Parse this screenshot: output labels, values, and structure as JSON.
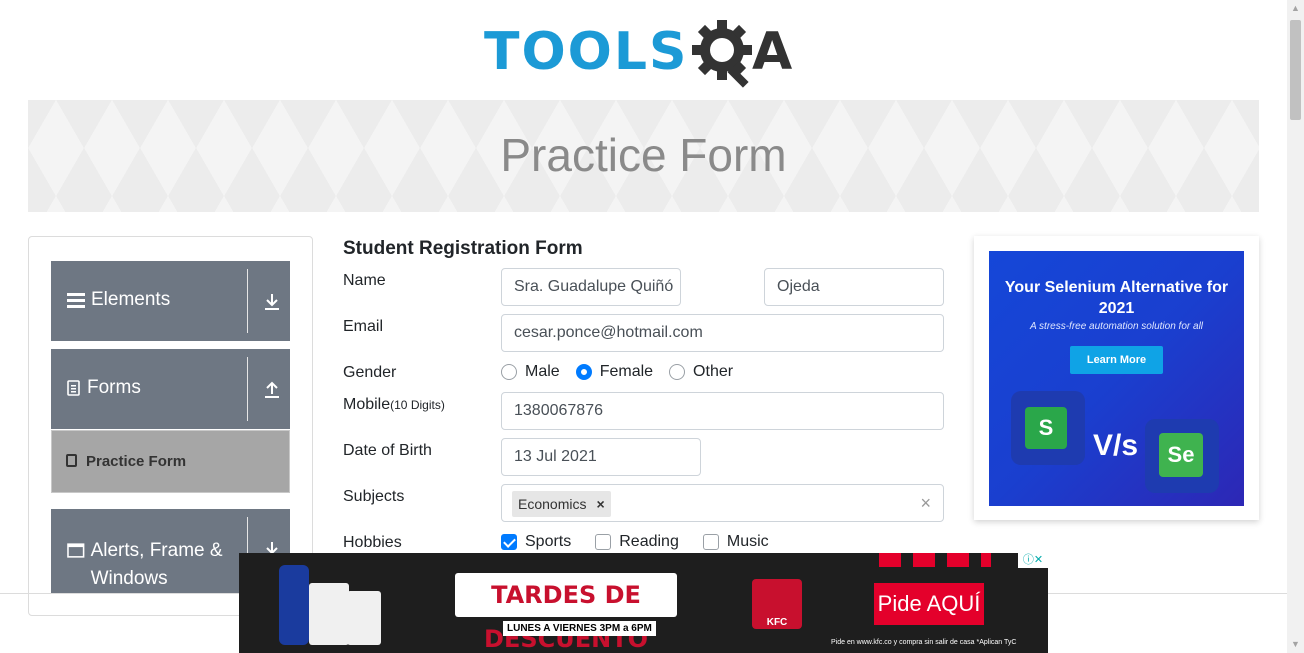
{
  "header": {
    "logo_text": "TOOLS",
    "logo_text_a": "A",
    "logo_name": "TOOLSQA"
  },
  "banner": {
    "title": "Practice Form"
  },
  "sidebar": {
    "groups": [
      {
        "label": "Elements",
        "icon": "menu-icon",
        "arrow": "download-icon"
      },
      {
        "label": "Forms",
        "icon": "document-icon",
        "arrow": "upload-icon"
      },
      {
        "label": "Alerts, Frame & Windows",
        "icon": "window-icon",
        "arrow": "download-icon"
      }
    ],
    "active_item": {
      "label": "Practice Form",
      "icon": "form-icon"
    }
  },
  "form": {
    "title": "Student Registration Form",
    "labels": {
      "name": "Name",
      "email": "Email",
      "gender": "Gender",
      "mobile": "Mobile",
      "mobile_hint": "(10 Digits)",
      "dob": "Date of Birth",
      "subjects": "Subjects",
      "hobbies": "Hobbies"
    },
    "first_name": "Sra. Guadalupe Quiñó",
    "last_name": "Ojeda",
    "email": "cesar.ponce@hotmail.com",
    "gender_options": [
      "Male",
      "Female",
      "Other"
    ],
    "gender_selected": "Female",
    "mobile": "1380067876",
    "dob": "13 Jul 2021",
    "subjects": [
      "Economics"
    ],
    "hobbies": [
      {
        "label": "Sports",
        "checked": true
      },
      {
        "label": "Reading",
        "checked": false
      },
      {
        "label": "Music",
        "checked": false
      }
    ]
  },
  "ad_right": {
    "headline": "Your Selenium Alternative for 2021",
    "subline": "A stress-free automation solution for all",
    "button": "Learn More",
    "vs": "V/s",
    "tile1": "S",
    "tile2": "Se"
  },
  "ad_bottom": {
    "promo": "TARDES DE DESCUENTO",
    "days": "LUNES A VIERNES 3PM a 6PM",
    "brand": "KFC",
    "cta": "Pide AQUÍ",
    "fine_print": "Pide en www.kfc.co y compra sin salir de casa *Aplican TyC"
  },
  "colors": {
    "brand_blue": "#1c9ad6",
    "sidebar_gray": "#6e7783",
    "accent": "#007bff"
  }
}
